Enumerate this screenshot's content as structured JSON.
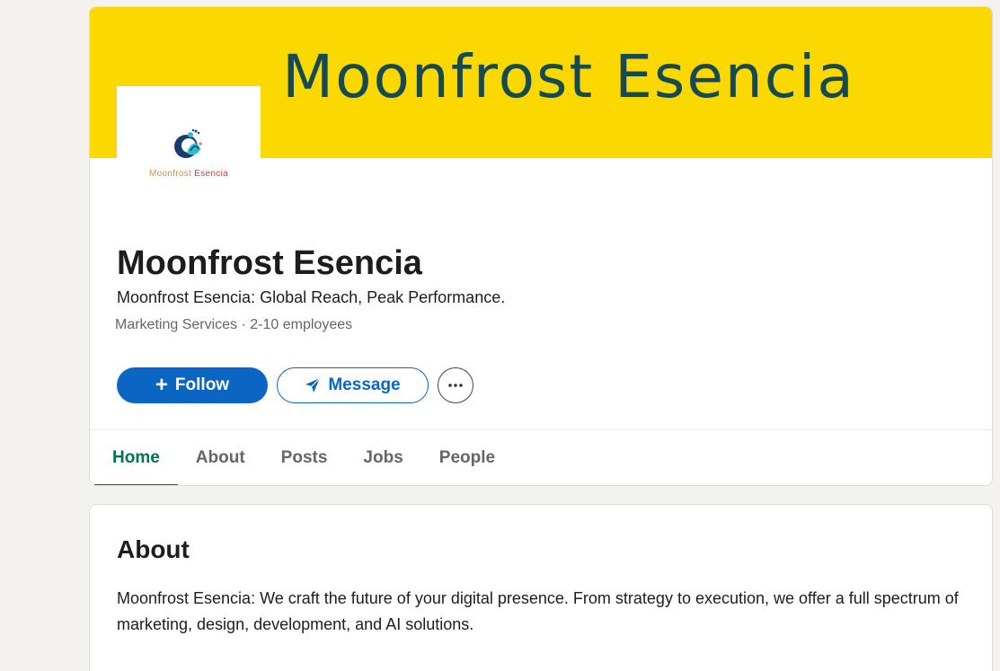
{
  "banner": {
    "text": "Moonfrost Esencia",
    "color": "#fbd900"
  },
  "logo": {
    "icon": "peacock-logo-icon",
    "caption_word1": "Moonfrost",
    "caption_word2": "Esencia"
  },
  "company": {
    "name": "Moonfrost Esencia",
    "tagline": "Moonfrost Esencia: Global Reach, Peak Performance.",
    "industry": "Marketing Services",
    "separator": "·",
    "size": "2-10 employees"
  },
  "actions": {
    "follow_label": "Follow",
    "follow_icon": "plus-icon",
    "message_label": "Message",
    "message_icon": "send-icon",
    "more_icon": "more-icon",
    "accent": "#0a66c2"
  },
  "tabs": [
    {
      "label": "Home",
      "active": true
    },
    {
      "label": "About",
      "active": false
    },
    {
      "label": "Posts",
      "active": false
    },
    {
      "label": "Jobs",
      "active": false
    },
    {
      "label": "People",
      "active": false
    }
  ],
  "tab_active_color": "#01754f",
  "about": {
    "title": "About",
    "text": "Moonfrost Esencia: We craft the future of your digital presence. From strategy to execution, we offer a full spectrum of marketing, design, development, and AI solutions."
  }
}
